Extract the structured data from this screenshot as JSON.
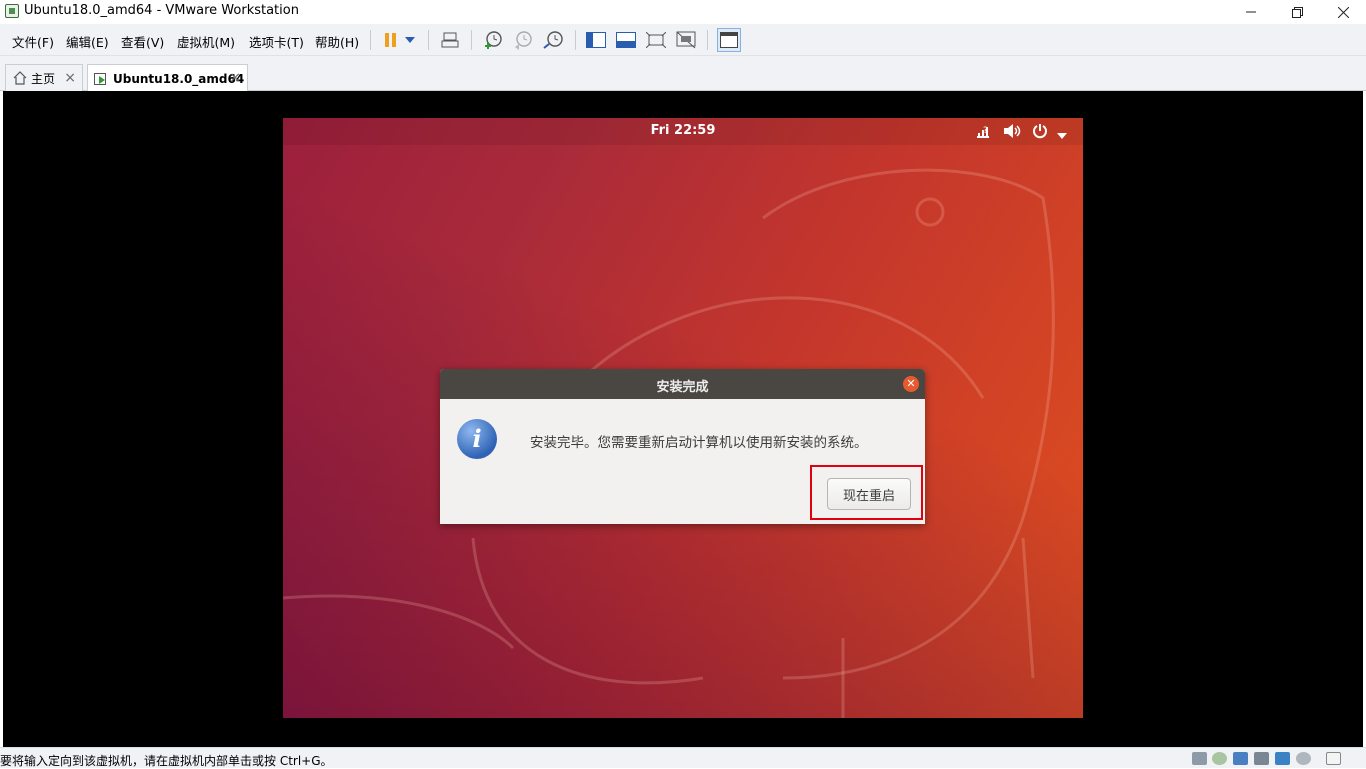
{
  "window": {
    "title": "Ubuntu18.0_amd64 - VMware Workstation"
  },
  "menu": {
    "items": [
      "文件(F)",
      "编辑(E)",
      "查看(V)",
      "虚拟机(M)",
      "选项卡(T)",
      "帮助(H)"
    ]
  },
  "tabs": [
    {
      "label": "主页",
      "active": false
    },
    {
      "label": "Ubuntu18.0_amd64",
      "active": true
    }
  ],
  "guest": {
    "clock": "Fri 22:59",
    "accent": "#e95420"
  },
  "dialog": {
    "title": "安装完成",
    "message": "安装完毕。您需要重新启动计算机以使用新安装的系统。",
    "button": "现在重启"
  },
  "status": {
    "text": "要将输入定向到该虚拟机，请在虚拟机内部单击或按 Ctrl+G。"
  }
}
